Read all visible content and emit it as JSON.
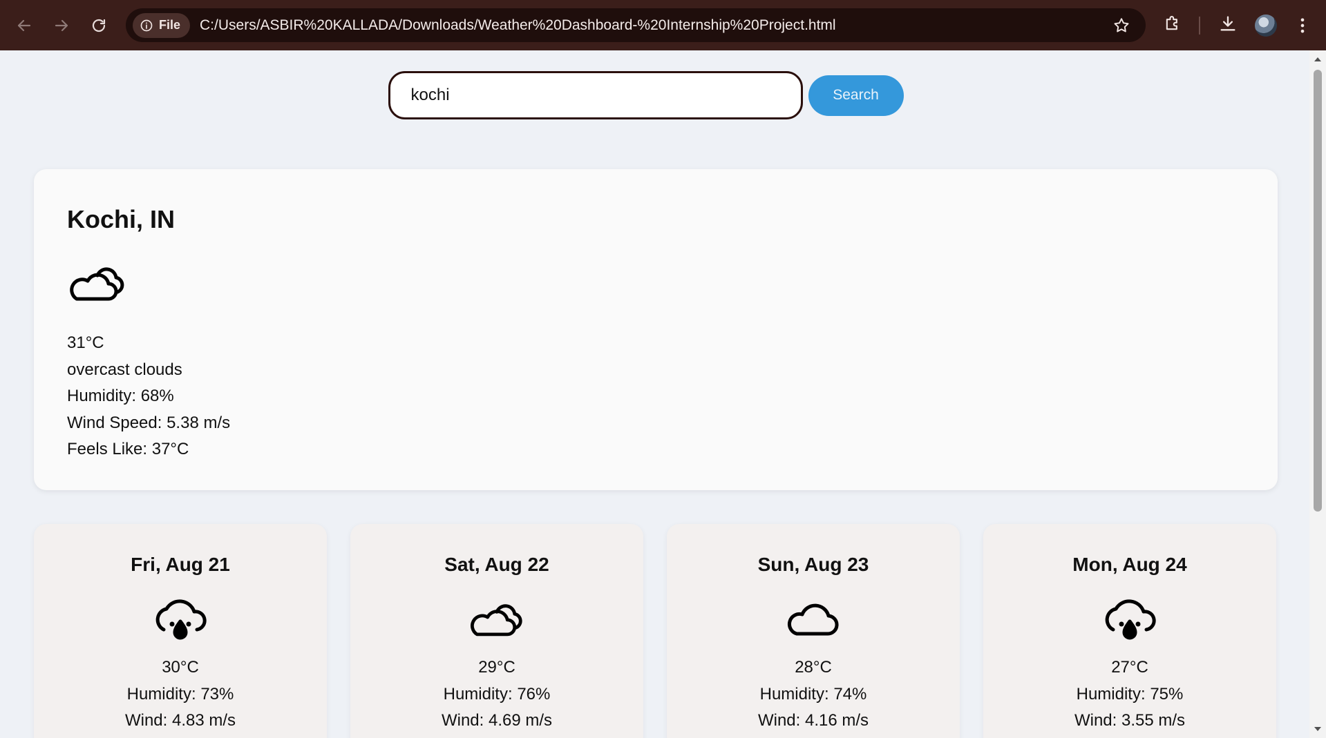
{
  "browser": {
    "site_chip_label": "File",
    "url": "C:/Users/ASBIR%20KALLADA/Downloads/Weather%20Dashboard-%20Internship%20Project.html"
  },
  "search": {
    "value": "kochi",
    "button_label": "Search"
  },
  "current": {
    "city": "Kochi, IN",
    "icon": "clouds-icon",
    "temperature": "31°C",
    "description": "overcast clouds",
    "humidity": "Humidity: 68%",
    "wind": "Wind Speed: 5.38 m/s",
    "feels_like": "Feels Like: 37°C"
  },
  "forecast": [
    {
      "date": "Fri, Aug 21",
      "icon": "cloud-rain-icon",
      "temperature": "30°C",
      "humidity": "Humidity: 73%",
      "wind": "Wind: 4.83 m/s"
    },
    {
      "date": "Sat, Aug 22",
      "icon": "clouds-icon",
      "temperature": "29°C",
      "humidity": "Humidity: 76%",
      "wind": "Wind: 4.69 m/s"
    },
    {
      "date": "Sun, Aug 23",
      "icon": "cloud-icon",
      "temperature": "28°C",
      "humidity": "Humidity: 74%",
      "wind": "Wind: 4.16 m/s"
    },
    {
      "date": "Mon, Aug 24",
      "icon": "cloud-rain-icon",
      "temperature": "27°C",
      "humidity": "Humidity: 75%",
      "wind": "Wind: 3.55 m/s"
    }
  ],
  "colors": {
    "chrome_bg": "#3b1e1a",
    "accent": "#3498db",
    "page_bg": "#eef1f6"
  }
}
